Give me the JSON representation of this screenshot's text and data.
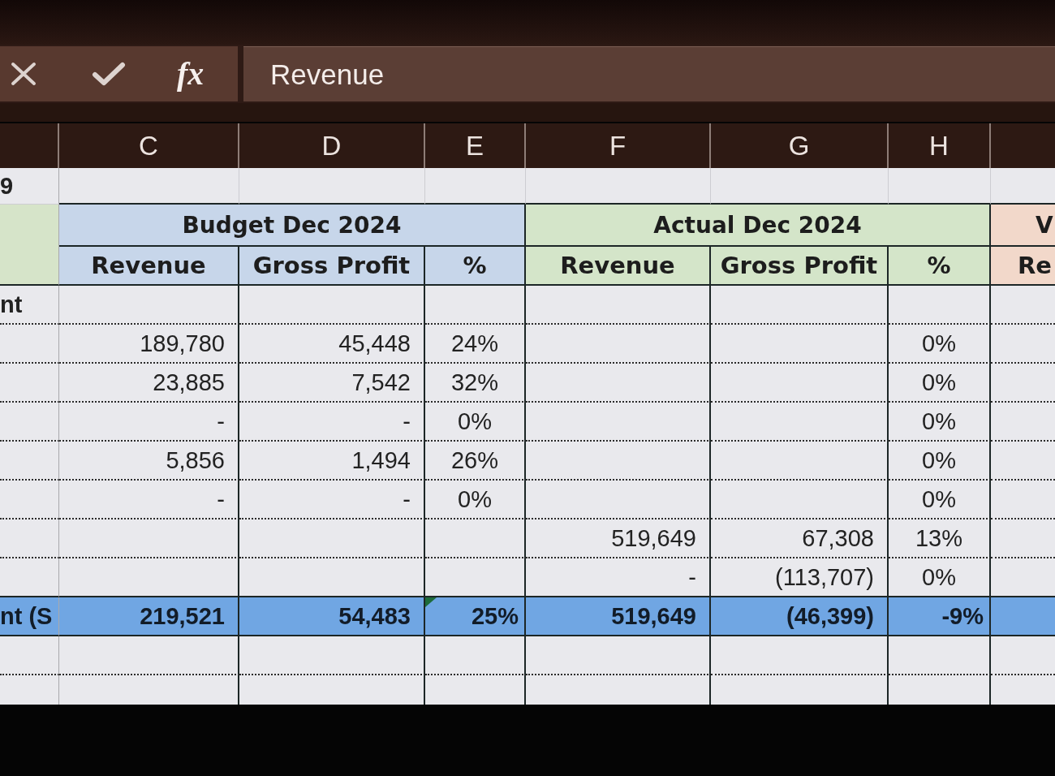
{
  "formula_bar": {
    "function_label": "fx",
    "value": "Revenue"
  },
  "column_headers": {
    "column_2": "C",
    "column_3": "D",
    "column_4": "E",
    "column_5": "F",
    "column_6": "G",
    "column_7": "H"
  },
  "sheet": {
    "rows": [
      {
        "kind": "plain",
        "cells": {
          "column_1": "9"
        }
      },
      {
        "kind": "group_header",
        "groups": [
          {
            "label": "Budget Dec 2024",
            "color": "#c7d6ea"
          },
          {
            "label": "Actual Dec 2024",
            "color": "#d4e5c9"
          },
          {
            "label": "V",
            "color": "#f2d8ca"
          }
        ]
      },
      {
        "kind": "column_header",
        "cells": {
          "column_2": "Revenue",
          "column_3": "Gross Profit",
          "column_4": "%",
          "column_5": "Revenue",
          "column_6": "Gross Profit",
          "column_7": "%",
          "column_8": "Re"
        }
      },
      {
        "kind": "section",
        "cells": {
          "column_1": "nt"
        }
      },
      {
        "kind": "data",
        "cells": {
          "column_2": "189,780",
          "column_3": "45,448",
          "column_4": "24%",
          "column_7": "0%"
        }
      },
      {
        "kind": "data",
        "cells": {
          "column_2": "23,885",
          "column_3": "7,542",
          "column_4": "32%",
          "column_7": "0%"
        }
      },
      {
        "kind": "data",
        "cells": {
          "column_2": "-",
          "column_3": "-",
          "column_4": "0%",
          "column_7": "0%"
        }
      },
      {
        "kind": "data",
        "cells": {
          "column_2": "5,856",
          "column_3": "1,494",
          "column_4": "26%",
          "column_7": "0%"
        }
      },
      {
        "kind": "data",
        "cells": {
          "column_2": "-",
          "column_3": "-",
          "column_4": "0%",
          "column_7": "0%"
        }
      },
      {
        "kind": "data",
        "cells": {
          "column_5": "519,649",
          "column_6": "67,308",
          "column_7": "13%"
        }
      },
      {
        "kind": "data",
        "cells": {
          "column_5": "-",
          "column_6": "(113,707)",
          "column_7": "0%"
        }
      },
      {
        "kind": "total",
        "cells": {
          "column_1": "nt (S",
          "column_2": "219,521",
          "column_3": "54,483",
          "column_4": {
            "text": "25%",
            "error_marker": true
          },
          "column_5": "519,649",
          "column_6": "(46,399)",
          "column_7": "-9%"
        }
      },
      {
        "kind": "plain"
      },
      {
        "kind": "plain"
      }
    ]
  }
}
